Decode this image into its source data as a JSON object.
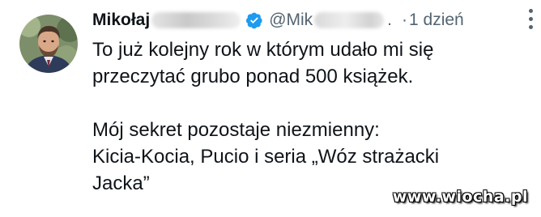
{
  "tweet": {
    "author": {
      "name": "Mikołaj",
      "handle": "@Mik",
      "verified": true
    },
    "timestamp": "1 dzień",
    "text_lines": [
      "To już kolejny rok w którym udało mi się",
      "przeczytać grubo ponad 500 książek."
    ],
    "text_lines_2": [
      "Mój sekret pozostaje niezmienny:",
      "Kicia-Kocia, Pucio i seria „Wóz strażacki",
      "Jacka”"
    ]
  },
  "watermark": "www.wiocha.pl",
  "colors": {
    "text": "#0f1419",
    "muted": "#536471",
    "verified": "#1d9bf0"
  },
  "icons": {
    "verified": "verified-badge-icon",
    "more": "more-options-icon"
  }
}
